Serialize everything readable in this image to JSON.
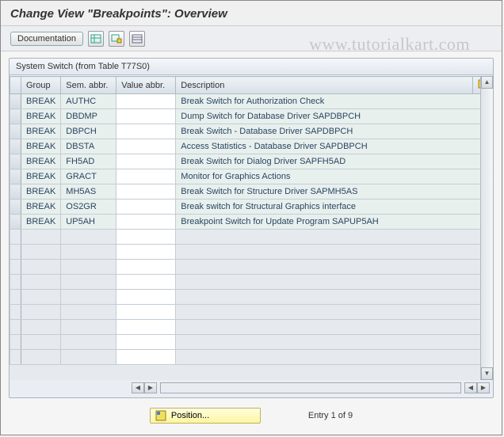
{
  "title": "Change View \"Breakpoints\": Overview",
  "toolbar": {
    "documentation": "Documentation"
  },
  "panel": {
    "title": "System Switch (from Table T77S0)"
  },
  "columns": {
    "group": "Group",
    "sem": "Sem. abbr.",
    "val": "Value abbr.",
    "desc": "Description"
  },
  "rows": [
    {
      "group": "BREAK",
      "sem": "AUTHC",
      "val": "",
      "desc": "Break Switch for Authorization Check"
    },
    {
      "group": "BREAK",
      "sem": "DBDMP",
      "val": "",
      "desc": "Dump Switch for Database Driver SAPDBPCH"
    },
    {
      "group": "BREAK",
      "sem": "DBPCH",
      "val": "",
      "desc": "Break Switch  -  Database Driver SAPDBPCH"
    },
    {
      "group": "BREAK",
      "sem": "DBSTA",
      "val": "",
      "desc": "Access Statistics  -  Database Driver SAPDBPCH"
    },
    {
      "group": "BREAK",
      "sem": "FH5AD",
      "val": "",
      "desc": "Break Switch for Dialog Driver SAPFH5AD"
    },
    {
      "group": "BREAK",
      "sem": "GRACT",
      "val": "",
      "desc": "Monitor for Graphics Actions"
    },
    {
      "group": "BREAK",
      "sem": "MH5AS",
      "val": "",
      "desc": "Break Switch for Structure Driver SAPMH5AS"
    },
    {
      "group": "BREAK",
      "sem": "OS2GR",
      "val": "",
      "desc": "Break switch for Structural Graphics interface"
    },
    {
      "group": "BREAK",
      "sem": "UP5AH",
      "val": "",
      "desc": "Breakpoint Switch for Update Program SAPUP5AH"
    }
  ],
  "empty_rows": 9,
  "footer": {
    "position_label": "Position...",
    "entry_text": "Entry 1 of 9"
  },
  "watermark": "www.tutorialkart.com"
}
